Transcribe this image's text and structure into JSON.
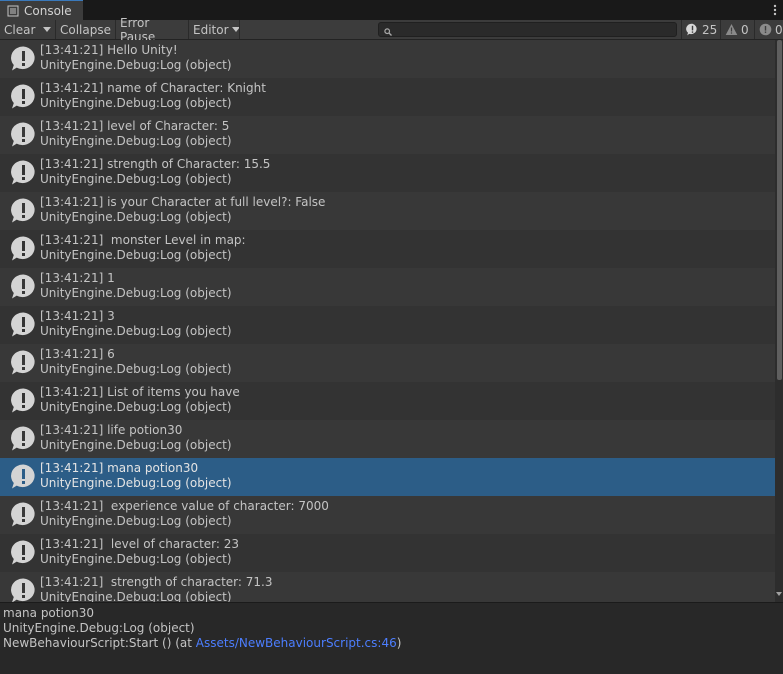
{
  "window": {
    "tab_title": "Console",
    "tab_icon": "console-list-icon",
    "menu_icon": "kebab-menu-icon"
  },
  "toolbar": {
    "clear_label": "Clear",
    "collapse_label": "Collapse",
    "error_pause_label": "Error Pause",
    "editor_label": "Editor",
    "search_placeholder": "",
    "log_count": "25",
    "warning_count": "0",
    "error_count": "0"
  },
  "log_entries": [
    {
      "time": "[13:41:21]",
      "message": "Hello Unity!",
      "source": "UnityEngine.Debug:Log (object)"
    },
    {
      "time": "[13:41:21]",
      "message": "name of Character: Knight",
      "source": "UnityEngine.Debug:Log (object)"
    },
    {
      "time": "[13:41:21]",
      "message": "level of Character: 5",
      "source": "UnityEngine.Debug:Log (object)"
    },
    {
      "time": "[13:41:21]",
      "message": "strength of Character: 15.5",
      "source": "UnityEngine.Debug:Log (object)"
    },
    {
      "time": "[13:41:21]",
      "message": "is your Character at full level?: False",
      "source": "UnityEngine.Debug:Log (object)"
    },
    {
      "time": "[13:41:21]",
      "message": " monster Level in map:",
      "source": "UnityEngine.Debug:Log (object)"
    },
    {
      "time": "[13:41:21]",
      "message": "1",
      "source": "UnityEngine.Debug:Log (object)"
    },
    {
      "time": "[13:41:21]",
      "message": "3",
      "source": "UnityEngine.Debug:Log (object)"
    },
    {
      "time": "[13:41:21]",
      "message": "6",
      "source": "UnityEngine.Debug:Log (object)"
    },
    {
      "time": "[13:41:21]",
      "message": "List of items you have",
      "source": "UnityEngine.Debug:Log (object)"
    },
    {
      "time": "[13:41:21]",
      "message": "life potion30",
      "source": "UnityEngine.Debug:Log (object)"
    },
    {
      "time": "[13:41:21]",
      "message": "mana potion30",
      "source": "UnityEngine.Debug:Log (object)",
      "selected": true
    },
    {
      "time": "[13:41:21]",
      "message": " experience value of character: 7000",
      "source": "UnityEngine.Debug:Log (object)"
    },
    {
      "time": "[13:41:21]",
      "message": " level of character: 23",
      "source": "UnityEngine.Debug:Log (object)"
    },
    {
      "time": "[13:41:21]",
      "message": " strength of character: 71.3",
      "source": "UnityEngine.Debug:Log (object)"
    }
  ],
  "detail": {
    "message": "mana potion30",
    "call1": "UnityEngine.Debug:Log (object)",
    "call2_prefix": "NewBehaviourScript:Start () (at ",
    "call2_link": "Assets/NewBehaviourScript.cs:46",
    "call2_suffix": ")"
  },
  "colors": {
    "selected_row": "#2c5d87",
    "link": "#4c7eff",
    "accent": "#3a79bb"
  }
}
